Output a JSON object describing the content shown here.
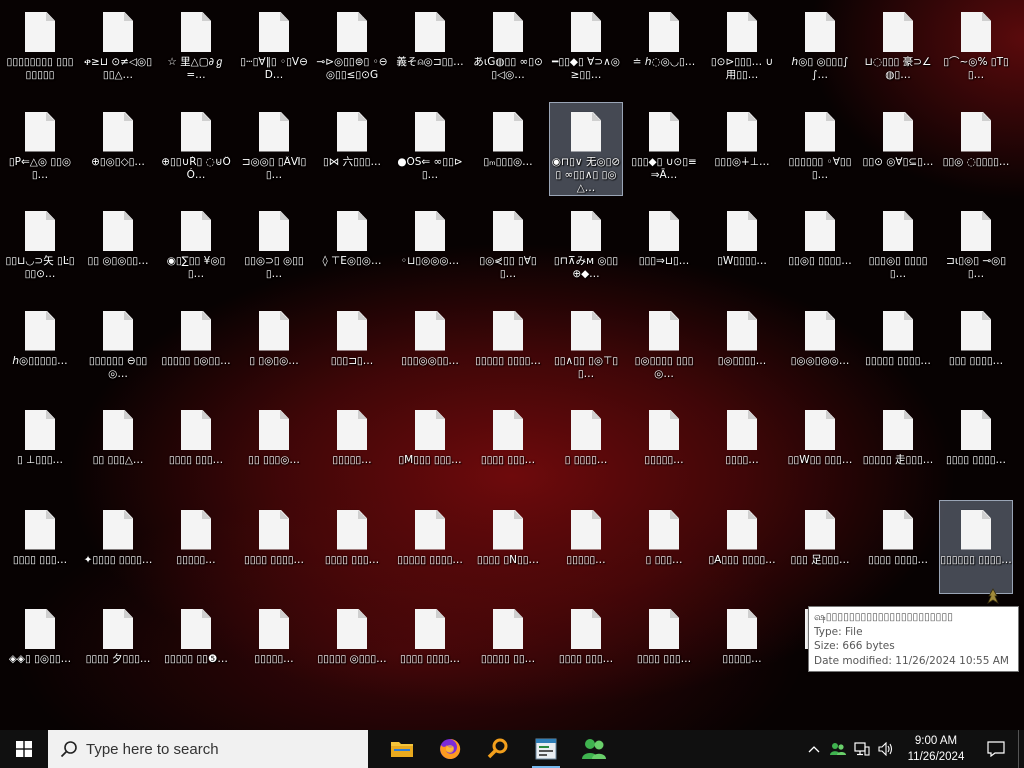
{
  "desktop": {
    "icons": [
      [
        "▯▯▯▯▯▯▯▯ ▯▯▯▯▯▯▯▯",
        "ቀ≥⊔ ⊙≠◁◎▯▯▯△…",
        "☆ 里△▢∂ℊ=…",
        "▯ⵈ▯∀∥▯ ◦▯V⊖D…",
        "⊸⊳◎▯▯⊜▯ ◦⊖◎▯▯≤▯⊙G",
        "義そ⍝◎⊐▯▯…",
        "あ⍳G◍▯▯ ∞▯⊙▯◁◎…",
        "━▯▯◆▯ ∀⊃∧◎≥▯▯…",
        "≐ ℎ◌◎◡▯…",
        "▯⊙⊳▯▯▯… ∪用▯▯…",
        "ℎ◎▯ ◎▯▯▯∫∫…",
        "⊔◌▯▯▯ 豪⊃∠◍▯…",
        "▯⌒~◎% ▯T▯▯…"
      ],
      [
        "▯P⇐△◎ ▯▯◎▯…",
        "⊕▯◎▯◇▯…",
        "⊕▯▯∪Ŕ▯ ◌⊍ÔÓ…",
        "⊐◎◎▯ ▯ÂⅥ▯▯…",
        "▯⋈ 六▯▯▯…",
        "●OS⇐ ∞▯▯⊳▯…",
        "▯ₘ▯▯▯◎…",
        "◉⊓▯∨ 无◎▯⊘▯ ∞▯▯∧▯ ▯◎△…",
        "▯▯▯◆▯ ∪⊙▯≡⇒Ā…",
        "▯▯▯◎∔⊥…",
        "▯▯▯▯▯▯ ◦∀▯▯▯…",
        "▯▯⊙ ◎∀▯⊆▯…",
        "▯▯◎ ◌▯▯▯▯…"
      ],
      [
        "▯▯⊔◡⊃矢 ▯Ŀ▯▯▯⊙…",
        "▯▯ ◎▯◎▯▯…",
        "◉▯∑▯▯ ¥◎▯▯…",
        "▯▯◎⊃▯ ◎▯▯▯…",
        "◊ ⊤E◎▯◎…",
        "◦⊔▯◎◎◎…",
        "▯◎⋞▯▯ ▯∀▯▯…",
        "▯⊓⊼みᴍ ◎▯▯⊕◆…",
        "▯▯▯⇒⊔▯…",
        "▯W▯▯▯▯…",
        "▯▯◎▯ ▯▯▯▯…",
        "▯▯▯◎▯ ▯▯▯▯▯…",
        "⊐⍳▯◎▯ ⊸◎▯▯…"
      ],
      [
        "ℎ◎▯▯▯▯▯…",
        "▯▯▯▯▯▯ ⊖▯▯◎…",
        "▯▯▯▯▯ ▯◎▯▯…",
        "▯ ▯◎▯◎…",
        "▯▯▯⊐▯…",
        "▯▯▯◎◎▯▯…",
        "▯▯▯▯▯ ▯▯▯▯…",
        "▯▯∧▯▯ ▯◎⊤▯▯…",
        "▯◎▯▯▯▯ ▯▯▯◎…",
        "▯◎▯▯▯▯…",
        "▯◎◎▯◎◎…",
        "▯▯▯▯▯ ▯▯▯▯…",
        "▯▯▯ ▯▯▯▯…"
      ],
      [
        "▯ ⊥▯▯▯…",
        "▯▯ ▯▯▯△…",
        "▯▯▯▯ ▯▯▯…",
        "▯▯ ▯▯▯◎…",
        "▯▯▯▯▯…",
        "▯M▯▯▯ ▯▯▯…",
        "▯▯▯▯ ▯▯▯…",
        "▯ ▯▯▯▯…",
        "▯▯▯▯▯…",
        "▯▯▯▯…",
        "▯▯W▯▯ ▯▯▯…",
        "▯▯▯▯▯ 走▯▯▯…",
        "▯▯▯▯ ▯▯▯▯…"
      ],
      [
        "▯▯▯▯ ▯▯▯…",
        "✦▯▯▯▯ ▯▯▯▯…",
        "▯▯▯▯▯…",
        "▯▯▯▯ ▯▯▯▯…",
        "▯▯▯▯ ▯▯▯…",
        "▯▯▯▯▯ ▯▯▯▯…",
        "▯▯▯▯ ▯N▯▯…",
        "▯▯▯▯▯…",
        "▯ ▯▯▯…",
        "▯A▯▯▯ ▯▯▯▯…",
        "▯▯▯ 足▯▯▯…",
        "▯▯▯▯ ▯▯▯▯…",
        "▯▯▯▯▯▯ ▯▯▯▯…"
      ],
      [
        "◈◈▯ ▯◎▯▯…",
        "▯▯▯▯ 夕▯▯▯…",
        "▯▯▯▯▯ ▯▯❺…",
        "▯▯▯▯▯…",
        "▯▯▯▯▯ ◎▯▯▯…",
        "▯▯▯▯ ▯▯▯▯…",
        "▯▯▯▯▯ ▯▯…",
        "▯▯▯▯ ▯▯▯…",
        "▯▯▯▯ ▯▯▯…",
        "▯▯▯▯▯…",
        "",
        "▯▯▯▯…",
        "▯▯▯▯…"
      ]
    ],
    "tooltip": {
      "name": "ஷ▯▯▯▯▯▯▯▯▯▯▯▯▯▯▯▯▯▯▯▯▯▯",
      "type": "Type: File",
      "size": "Size: 666 bytes",
      "modified": "Date modified: 11/26/2024 10:55 AM"
    }
  },
  "taskbar": {
    "search_placeholder": "Type here to search",
    "time": "9:00 AM",
    "date": "11/26/2024"
  }
}
